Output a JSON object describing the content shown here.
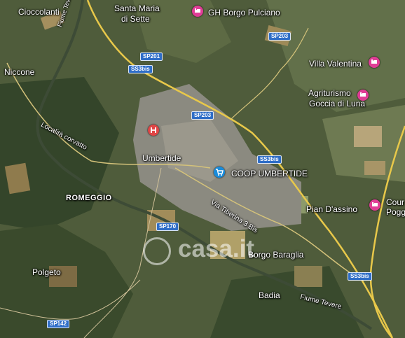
{
  "places": {
    "cioccolanti": "Cioccolanti",
    "santa_maria": "Santa Maria",
    "di_sette": "di Sette",
    "niccone": "Niccone",
    "umbertide": "Umbertide",
    "romeggio": "ROMEGGIO",
    "polgeto": "Polgeto",
    "borgo_baraglia": "Borgo Baraglia",
    "badia": "Badia",
    "pian_dassino": "Pian D'assino",
    "villa_valentina": "Villa Valentina",
    "agriturismo": "Agriturismo",
    "goccia_di_luna": "Goccia di Luna",
    "gh_borgo_pulciano": "GH Borgo Pulciano",
    "coop_umbertide": "COOP UMBERTIDE",
    "cour": "Cour",
    "pogg": "Pogg"
  },
  "streets": {
    "fiume_tevere_top": "Fiume Tevere",
    "localita_corvatto": "Località corvatto",
    "via_tiberina": "Via Tiberina 3 Bis",
    "fiume_tevere_bottom": "Fiume Tevere"
  },
  "roads": {
    "sp201": "SP201",
    "ss3bis_a": "SS3bis",
    "sp203_a": "SP203",
    "sp203_b": "SP203",
    "ss3bis_b": "SS3bis",
    "sp170": "SP170",
    "ss3bis_c": "SS3bis",
    "sp142": "SP142"
  },
  "watermark": "casa.it",
  "colors": {
    "hotel_pin": "#e03d96",
    "shop_pin": "#1a8cdb",
    "hospital_pin": "#e04545",
    "road_badge": "#2f6ec8"
  }
}
